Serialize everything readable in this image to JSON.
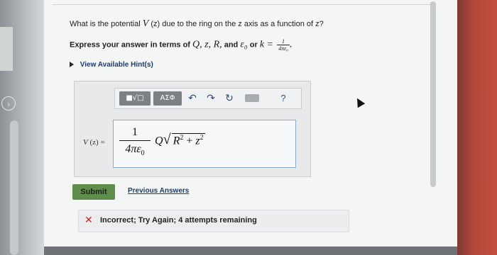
{
  "question": {
    "prefix": "What is the potential",
    "var_v": "V",
    "var_arg": "(z)",
    "suffix": "due to the ring on the z axis as a function of z?"
  },
  "instruction": {
    "text": "Express your answer in terms of",
    "vars": "Q, z, R,",
    "and_text": "and",
    "eps": "ε₀",
    "or_text": "or",
    "k_eq": "k =",
    "k_num": "1",
    "k_den": "4πε₀"
  },
  "hints": {
    "label": "View Available Hint(s)"
  },
  "toolbar": {
    "templates_label": "■√□",
    "symbols_label": "ΑΣΦ",
    "undo_icon": "↶",
    "redo_icon": "↷",
    "reset_icon": "↻",
    "help_label": "?"
  },
  "answer": {
    "lhs_v": "V",
    "lhs_arg": "(z) =",
    "frac_num": "1",
    "frac_den": "4πε",
    "frac_den_sub": "0",
    "rhs_q": "Q",
    "rhs_sqrt_r": "R",
    "rhs_sqrt_r_exp": "2",
    "rhs_plus": " + ",
    "rhs_sqrt_z": "z",
    "rhs_sqrt_z_exp": "2"
  },
  "actions": {
    "submit_label": "Submit",
    "previous_label": "Previous Answers"
  },
  "feedback": {
    "icon": "✕",
    "message": "Incorrect; Try Again; 4 attempts remaining"
  },
  "colors": {
    "submit_bg": "#5f8e4c",
    "error": "#c7261d",
    "link": "#1a3e6e"
  }
}
